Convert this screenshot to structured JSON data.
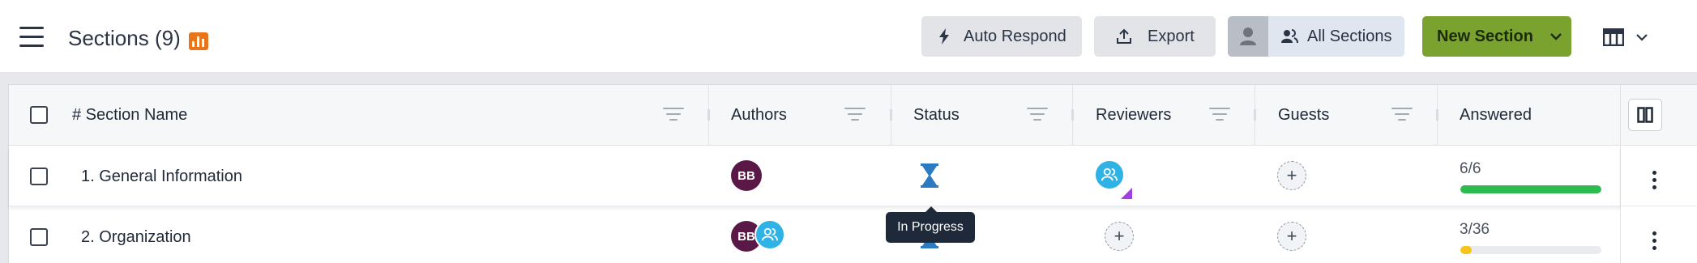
{
  "header": {
    "title": "Sections (9)",
    "auto_respond_label": "Auto Respond",
    "export_label": "Export",
    "all_sections_label": "All Sections",
    "new_section_label": "New Section"
  },
  "columns": {
    "section_name": "# Section Name",
    "authors": "Authors",
    "status": "Status",
    "reviewers": "Reviewers",
    "guests": "Guests",
    "answered": "Answered"
  },
  "rows": [
    {
      "name": "1. General Information",
      "author_initials": "BB",
      "answered": "6/6",
      "progress": 1.0,
      "progress_color": "#2dba4e"
    },
    {
      "name": "2. Organization",
      "author_initials": "BB",
      "answered": "3/36",
      "progress": 0.083,
      "progress_color": "#f5c518"
    }
  ],
  "tooltip": "In Progress",
  "colors": {
    "accent_green": "#7aa22e",
    "status_blue": "#2c7bc0",
    "avatar_purple": "#5a1846",
    "reviewer_blue": "#2fb2e6",
    "badge_orange": "#e8741b"
  }
}
